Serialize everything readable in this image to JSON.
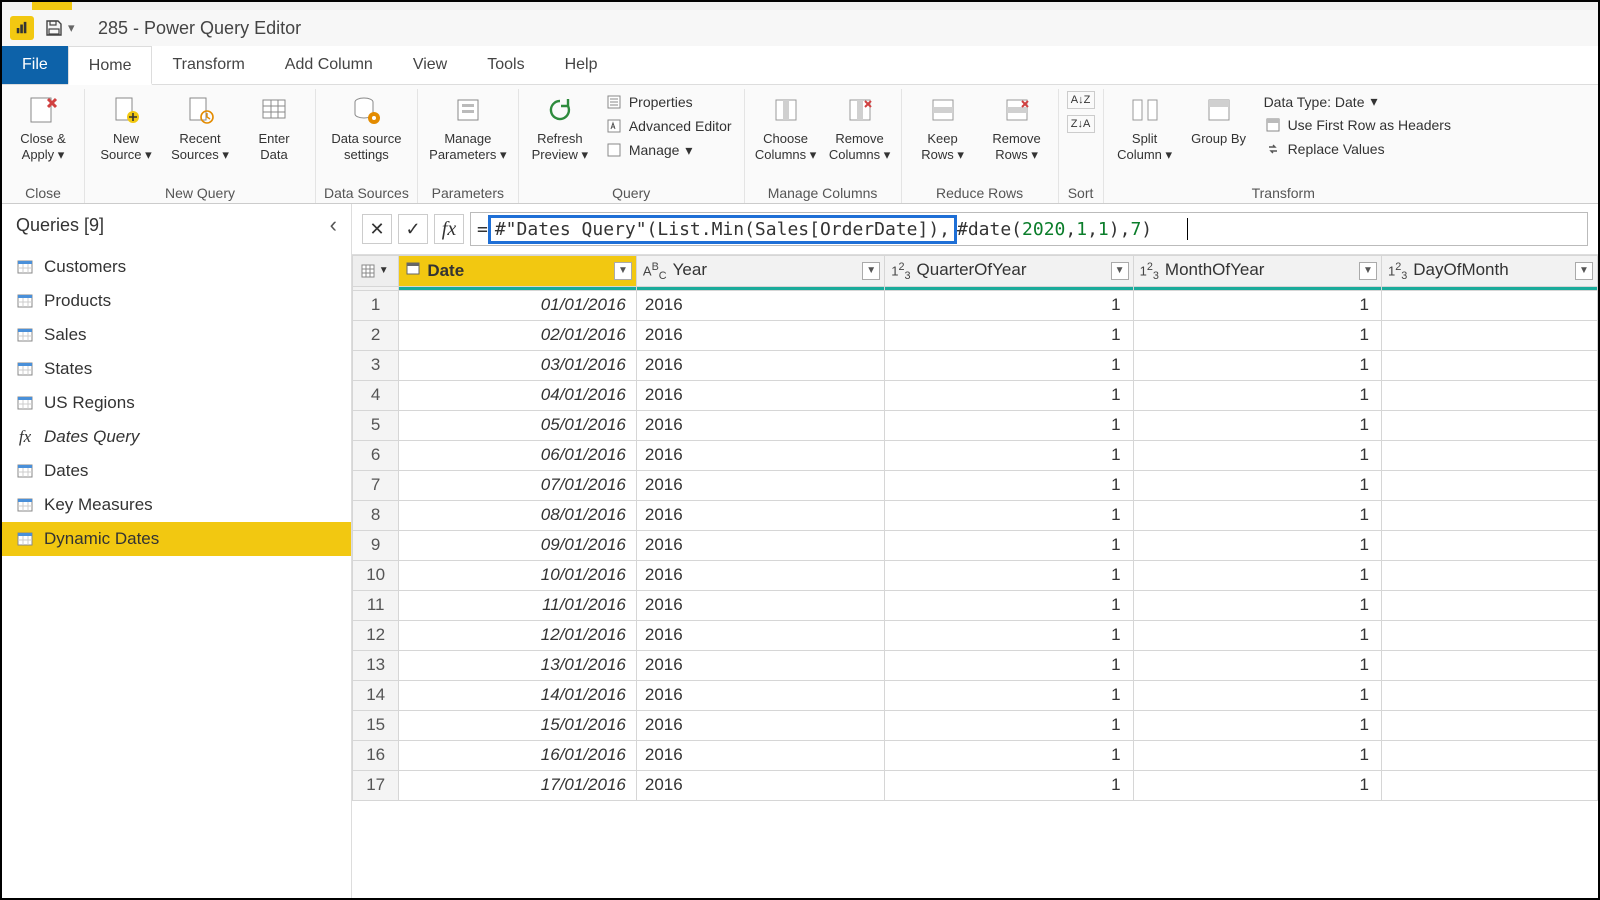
{
  "title": "285 - Power Query Editor",
  "tabs": {
    "file": "File",
    "home": "Home",
    "transform": "Transform",
    "addcol": "Add Column",
    "view": "View",
    "tools": "Tools",
    "help": "Help"
  },
  "ribbon": {
    "close_apply": "Close & Apply",
    "close_group": "Close",
    "new_source": "New Source",
    "recent_sources": "Recent Sources",
    "enter_data": "Enter Data",
    "new_query_group": "New Query",
    "data_source_settings": "Data source settings",
    "data_sources_group": "Data Sources",
    "manage_parameters": "Manage Parameters",
    "parameters_group": "Parameters",
    "refresh_preview": "Refresh Preview",
    "properties": "Properties",
    "advanced_editor": "Advanced Editor",
    "manage": "Manage",
    "query_group": "Query",
    "choose_columns": "Choose Columns",
    "remove_columns": "Remove Columns",
    "manage_columns_group": "Manage Columns",
    "keep_rows": "Keep Rows",
    "remove_rows": "Remove Rows",
    "reduce_rows_group": "Reduce Rows",
    "sort_group": "Sort",
    "split_column": "Split Column",
    "group_by": "Group By",
    "data_type": "Data Type: Date",
    "use_first_row": "Use First Row as Headers",
    "replace_values": "Replace Values",
    "transform_group": "Transform"
  },
  "queries": {
    "header": "Queries [9]",
    "items": [
      {
        "label": "Customers",
        "type": "table"
      },
      {
        "label": "Products",
        "type": "table"
      },
      {
        "label": "Sales",
        "type": "table"
      },
      {
        "label": "States",
        "type": "table"
      },
      {
        "label": "US Regions",
        "type": "table"
      },
      {
        "label": "Dates Query",
        "type": "fx",
        "italic": true
      },
      {
        "label": "Dates",
        "type": "table"
      },
      {
        "label": "Key Measures",
        "type": "table"
      },
      {
        "label": "Dynamic Dates",
        "type": "table",
        "selected": true
      }
    ]
  },
  "formula": {
    "eq": "= ",
    "selected": "#\"Dates Query\"(List.Min(Sales[OrderDate]),",
    "after_pre": " #date(",
    "year": "2020",
    "mid1": ", ",
    "one_a": "1",
    "mid2": ", ",
    "one_b": "1",
    "mid3": "), ",
    "seven": "7",
    "end": ")"
  },
  "columns": [
    {
      "name": "Date",
      "type": "date",
      "selected": true
    },
    {
      "name": "Year",
      "type": "text"
    },
    {
      "name": "QuarterOfYear",
      "type": "num"
    },
    {
      "name": "MonthOfYear",
      "type": "num"
    },
    {
      "name": "DayOfMonth",
      "type": "num"
    }
  ],
  "rows": [
    {
      "n": "1",
      "date": "01/01/2016",
      "year": "2016",
      "q": "1",
      "m": "1"
    },
    {
      "n": "2",
      "date": "02/01/2016",
      "year": "2016",
      "q": "1",
      "m": "1"
    },
    {
      "n": "3",
      "date": "03/01/2016",
      "year": "2016",
      "q": "1",
      "m": "1"
    },
    {
      "n": "4",
      "date": "04/01/2016",
      "year": "2016",
      "q": "1",
      "m": "1"
    },
    {
      "n": "5",
      "date": "05/01/2016",
      "year": "2016",
      "q": "1",
      "m": "1"
    },
    {
      "n": "6",
      "date": "06/01/2016",
      "year": "2016",
      "q": "1",
      "m": "1"
    },
    {
      "n": "7",
      "date": "07/01/2016",
      "year": "2016",
      "q": "1",
      "m": "1"
    },
    {
      "n": "8",
      "date": "08/01/2016",
      "year": "2016",
      "q": "1",
      "m": "1"
    },
    {
      "n": "9",
      "date": "09/01/2016",
      "year": "2016",
      "q": "1",
      "m": "1"
    },
    {
      "n": "10",
      "date": "10/01/2016",
      "year": "2016",
      "q": "1",
      "m": "1"
    },
    {
      "n": "11",
      "date": "11/01/2016",
      "year": "2016",
      "q": "1",
      "m": "1"
    },
    {
      "n": "12",
      "date": "12/01/2016",
      "year": "2016",
      "q": "1",
      "m": "1"
    },
    {
      "n": "13",
      "date": "13/01/2016",
      "year": "2016",
      "q": "1",
      "m": "1"
    },
    {
      "n": "14",
      "date": "14/01/2016",
      "year": "2016",
      "q": "1",
      "m": "1"
    },
    {
      "n": "15",
      "date": "15/01/2016",
      "year": "2016",
      "q": "1",
      "m": "1"
    },
    {
      "n": "16",
      "date": "16/01/2016",
      "year": "2016",
      "q": "1",
      "m": "1"
    },
    {
      "n": "17",
      "date": "17/01/2016",
      "year": "2016",
      "q": "1",
      "m": "1"
    }
  ]
}
